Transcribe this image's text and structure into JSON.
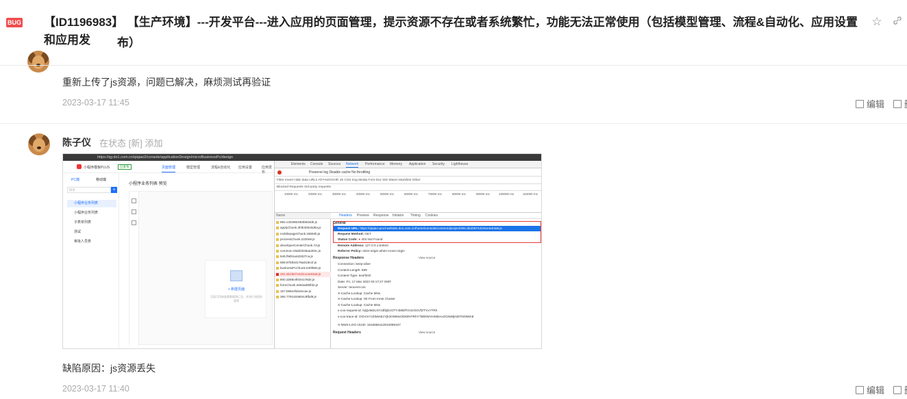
{
  "header": {
    "badge": "BUG",
    "id": "【ID1196983】",
    "title_line1": "【生产环境】---开发平台---进入应用的页面管理，提示资源不存在或者系统繁忙，功能无法正常使用（包括模型管理、流程&自动化、应用设置和应用发",
    "title_line2": "布）",
    "icons": [
      "star-icon",
      "link-icon"
    ]
  },
  "comments": [
    {
      "text": "重新上传了js资源，问题已解决，麻烦测试再验证",
      "time": "2023-03-17 11:45",
      "edit_label": "编辑",
      "delete_label": "删"
    },
    {
      "author": "陈子仪",
      "status": "在状态 [新] 添加",
      "text": "缺陷原因：js资源丢失",
      "time": "2023-03-17 11:40",
      "edit_label": "编辑",
      "delete_label": "删"
    }
  ],
  "screenshot": {
    "url": "https://qy.do1.com.cn/qiqiao2/console/applicationDesign/microBusinessPc/design",
    "app_name": "小程序模板PLUS",
    "app_tag": "已发布",
    "app_tabs": [
      "页面管理",
      "模型管理",
      "流程&自动化",
      "应用设置",
      "应用发布"
    ],
    "nav_modes": [
      "PC端",
      "移动端"
    ],
    "nav_search": "搜索",
    "nav_items": [
      "小程序业务列表",
      "小程序业务列表",
      "子表单列表",
      "测试",
      "审批人员表"
    ],
    "page_title": "小程序业务列表 预览",
    "empty_button": "+ 新建页面",
    "empty_tip": "页面可用来查看数据和汇总，并进行流程处理等",
    "devtools_tabs": [
      "Elements",
      "Console",
      "Sources",
      "Network",
      "Performance",
      "Memory",
      "Application",
      "Security",
      "Lighthouse"
    ],
    "toolbar_text": "Preserve log   Disable cache   No throttling",
    "filter_text": "Filter    Invert   Hide data URLs   All   Fetch/XHR   JS   CSS   Img   Media   Font   Doc   WS   Wasm   Manifest   Other",
    "blocked_text": "Blocked Requests    3rd-party requests",
    "ticks": [
      "10000 ms",
      "20000 ms",
      "30000 ms",
      "40000 ms",
      "50000 ms",
      "60000 ms",
      "70000 ms",
      "80000 ms",
      "90000 ms",
      "100000 ms",
      "110000 ms"
    ],
    "reqlist_header": "Name",
    "requests": [
      "892.cd4298c883b9d4d0.js",
      "applyChunk.3f4b40616d0a.js",
      "mobilepageChunk.18694b.js",
      "processChunk.2220e8.js",
      "developerCenterChunk.7d.js",
      "common.25dd3348aa302c.js",
      "546.f9d91a4d2d27ca.js",
      "559.875934175a616e1f.js",
      "businessPcChunk.640f656.js",
      "491.5b1b874423ce4e63a8.js",
      "800.d288c8f404178d4.js",
      "formChunk.e653ad90fd2.js",
      "157.b66e4fd44ecae.js",
      "394.7791404804c9fbd9.js"
    ],
    "detail_tabs": [
      "Headers",
      "Preview",
      "Response",
      "Initiator",
      "Timing",
      "Cookies"
    ],
    "general_label": "General",
    "request_url_label": "Request URL:",
    "request_url": "https://qiqiao-prod-website.do1.com.cn/home/console/common/project/491.5b1b874423ce4e63a8.js",
    "request_method_label": "Request Method:",
    "request_method": "GET",
    "status_code_label": "Status Code:",
    "status_code": "404 Not Found",
    "remote_label": "Remote Address:",
    "remote_value": "127.0.0.1:54944",
    "referrer_label": "Referrer Policy:",
    "referrer_value": "strict-origin-when-cross-origin",
    "response_headers_label": "Response Headers",
    "view_source": "View source",
    "response_headers": [
      "Connection: keep-alive",
      "Content-Length: 589",
      "Content-Type: text/html",
      "Date: Fri, 17 Mar 2023 03:17:27 GMT",
      "Server: tencent-cos",
      "X-Cache-Lookup: Cache Miss",
      "X-Cache-Lookup: Hit From Inner Cluster",
      "X-Cache-Lookup: Cache Miss",
      "x-cos-request-id: NjQxM2U4YzdfZjEzOTY4MDlfYmIzOGVfZTYxYTRh",
      "x-cos-trace-id: OGVmYzZiMmEzYjk3OWMxODk0NTRhYTBlOWVmMDAxOGNiMjNiOTM3MmE",
      "X-NWS-LOG-UUID: 1616865112534086347"
    ],
    "request_headers_label": "Request Headers"
  }
}
